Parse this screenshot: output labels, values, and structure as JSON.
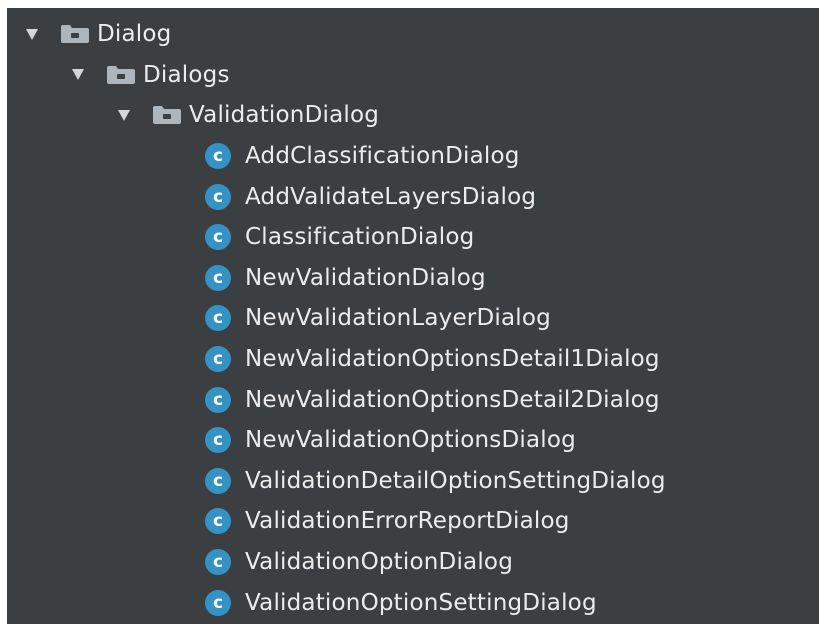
{
  "tree": {
    "root": {
      "label": "Dialog",
      "icon": "folder-icon",
      "expanded": true
    },
    "child": {
      "label": "Dialogs",
      "icon": "folder-icon",
      "expanded": true
    },
    "grandchild": {
      "label": "ValidationDialog",
      "icon": "folder-icon",
      "expanded": true
    },
    "class_glyph": "c",
    "classes": [
      "AddClassificationDialog",
      "AddValidateLayersDialog",
      "ClassificationDialog",
      "NewValidationDialog",
      "NewValidationLayerDialog",
      "NewValidationOptionsDetail1Dialog",
      "NewValidationOptionsDetail2Dialog",
      "NewValidationOptionsDialog",
      "ValidationDetailOptionSettingDialog",
      "ValidationErrorReportDialog",
      "ValidationOptionDialog",
      "ValidationOptionSettingDialog"
    ]
  },
  "colors": {
    "background": "#3c3f41",
    "text": "#ececec",
    "arrow": "#d5d6d7",
    "folder": "#aeb6bd",
    "class_icon": "#3592c4"
  }
}
